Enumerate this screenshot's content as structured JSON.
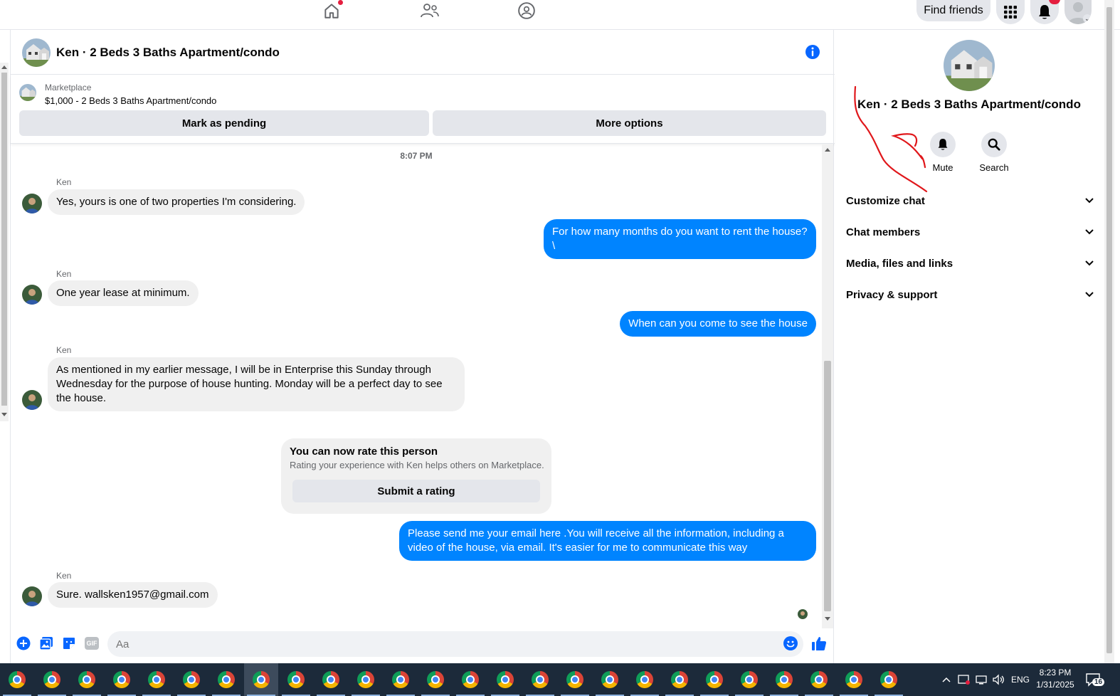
{
  "topnav": {
    "find_friends": "Find friends",
    "notification_badge": ""
  },
  "chat": {
    "title": "Ken · 2 Beds 3 Baths Apartment/condo",
    "listing": {
      "source": "Marketplace",
      "price_title": "$1,000 - 2 Beds 3 Baths Apartment/condo",
      "mark_pending": "Mark as pending",
      "more_options": "More options"
    },
    "timestamp": "8:07 PM",
    "messages": [
      {
        "sender": "Ken",
        "text": "Yes, yours is one of two properties I'm considering."
      },
      {
        "text": "For how many months do you want to rent the house?\n\\"
      },
      {
        "sender": "Ken",
        "text": "One year lease at minimum."
      },
      {
        "text": "When can you come to see the house"
      },
      {
        "sender": "Ken",
        "text": "As mentioned in my earlier message, I will be in Enterprise this Sunday through Wednesday for the purpose of house hunting. Monday will be a perfect day to see the house."
      },
      {
        "text": "Please send me your email here .You will receive all the information, including a video of the house, via email. It's easier for me to communicate this way"
      },
      {
        "sender": "Ken",
        "text": "Sure. wallsken1957@gmail.com"
      }
    ],
    "rating": {
      "title": "You can now rate this person",
      "subtitle": "Rating your experience with Ken helps others on Marketplace.",
      "button": "Submit a rating"
    },
    "composer": {
      "placeholder": "Aa",
      "gif_label": "GIF"
    }
  },
  "right_panel": {
    "title": "Ken · 2 Beds 3 Baths Apartment/condo",
    "actions": [
      {
        "label": "Mute",
        "icon": "bell-icon"
      },
      {
        "label": "Search",
        "icon": "search-icon"
      }
    ],
    "sections": [
      {
        "label": "Customize chat"
      },
      {
        "label": "Chat members"
      },
      {
        "label": "Media, files and links"
      },
      {
        "label": "Privacy & support"
      }
    ]
  },
  "taskbar": {
    "app_count": 26,
    "language": "ENG",
    "time": "8:23 PM",
    "date": "1/31/2025",
    "notification_count": "16"
  },
  "colors": {
    "accent": "#0084ff",
    "bubble_in": "#f0f0f0",
    "button_bg": "#e4e6eb",
    "annotation_red": "#e0171b"
  }
}
